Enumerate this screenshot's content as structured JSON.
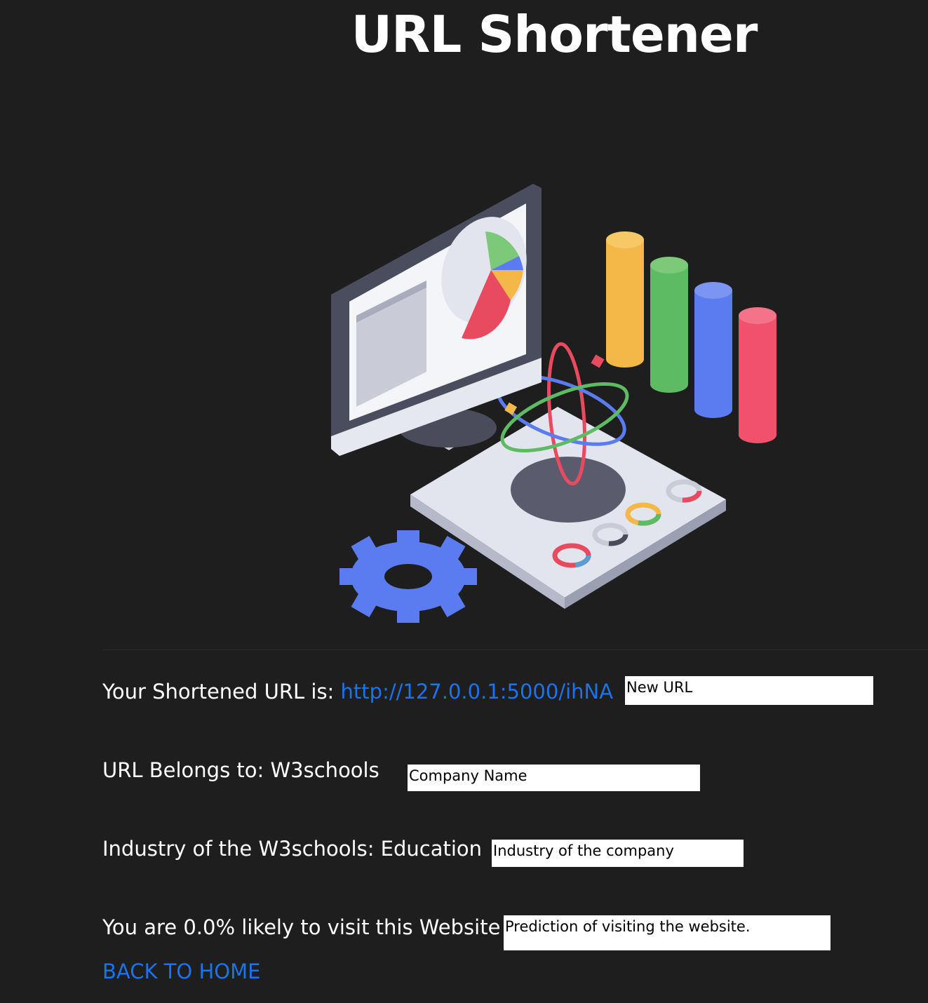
{
  "header": {
    "title": "URL Shortener"
  },
  "illustration": {
    "icon": "data-analytics-illustration"
  },
  "result": {
    "short_url_label": "Your Shortened URL is: ",
    "short_url_value": "http://127.0.0.1:5000/ihNA",
    "company_line": "URL Belongs to: W3schools",
    "industry_line": "Industry of the W3schools: Education",
    "prediction_line": "You are 0.0% likely to visit this Website"
  },
  "annotations": {
    "new_url": "New URL",
    "company_name": "Company Name",
    "industry": "Industry of the company",
    "prediction": "Prediction of visiting the website."
  },
  "nav": {
    "back_home": "BACK TO HOME"
  },
  "colors": {
    "background": "#1e1e1e",
    "link": "#1a73f0",
    "text": "#ffffff"
  }
}
